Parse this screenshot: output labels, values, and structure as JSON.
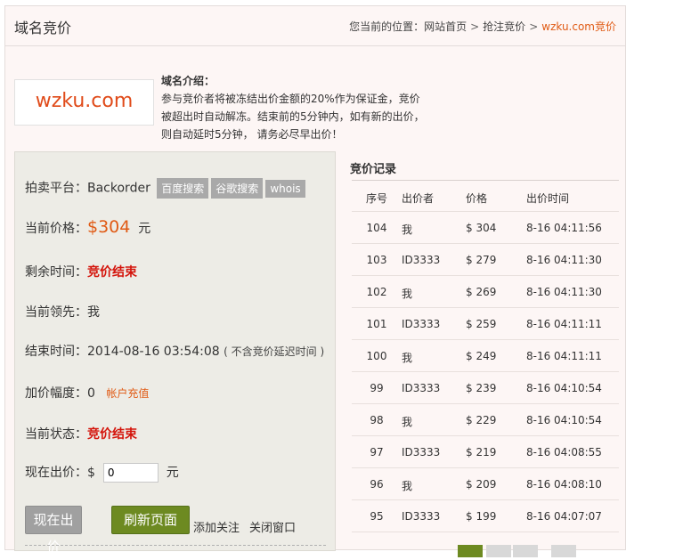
{
  "header": {
    "title": "域名竞价",
    "breadcrumb": {
      "prefix": "您当前的位置：",
      "items": [
        "网站首页",
        "抢注竞价"
      ],
      "separator": ">",
      "current": "wzku.com竞价"
    }
  },
  "domain": {
    "logo_text": "wzku.com",
    "intro_heading": "域名介绍：",
    "intro_lines": [
      "参与竞价者将被冻结出价金额的20%作为保证金，竞价",
      "被超出时自动解冻。结束前的5分钟内，如有新的出价，",
      "则自动延时5分钟， 请务必尽早出价！"
    ]
  },
  "auction": {
    "platform_label": "拍卖平台：",
    "platform_value": "Backorder",
    "tags": [
      "百度搜索",
      "谷歌搜索",
      "whois"
    ],
    "price_label": "当前价格：",
    "price_value": "$304",
    "price_unit": "元",
    "remaining_label": "剩余时间：",
    "remaining_value": "竞价结束",
    "leader_label": "当前领先：",
    "leader_value": "我",
    "end_label": "结束时间：",
    "end_value": "2014-08-16 03:54:08",
    "end_note": "( 不含竞价延迟时间 )",
    "increment_label": "加价幅度：",
    "increment_value": "0",
    "recharge_link": "帐户充值",
    "status_label": "当前状态：",
    "status_value": "竞价结束",
    "bid_label": "现在出价：",
    "bid_currency": "$",
    "bid_input_value": "0",
    "bid_unit": "元",
    "bid_button": "现在出价",
    "refresh_button": "刷新页面",
    "follow_link": "添加关注",
    "close_link": "关闭窗口"
  },
  "records": {
    "title": "竞价记录",
    "columns": [
      "序号",
      "出价者",
      "价格",
      "出价时间"
    ],
    "rows": [
      [
        "104",
        "我",
        "$ 304",
        "8-16 04:11:56"
      ],
      [
        "103",
        "ID3333",
        "$ 279",
        "8-16 04:11:30"
      ],
      [
        "102",
        "我",
        "$ 269",
        "8-16 04:11:30"
      ],
      [
        "101",
        "ID3333",
        "$ 259",
        "8-16 04:11:11"
      ],
      [
        "100",
        "我",
        "$ 249",
        "8-16 04:11:11"
      ],
      [
        "99",
        "ID3333",
        "$ 239",
        "8-16 04:10:54"
      ],
      [
        "98",
        "我",
        "$ 229",
        "8-16 04:10:54"
      ],
      [
        "97",
        "ID3333",
        "$ 219",
        "8-16 04:08:55"
      ],
      [
        "96",
        "我",
        "$ 209",
        "8-16 04:08:10"
      ],
      [
        "95",
        "ID3333",
        "$ 199",
        "8-16 04:07:07"
      ]
    ]
  },
  "colors": {
    "accent_orange": "#e05a14",
    "status_red": "#d4140b",
    "button_green": "#6d8a21"
  }
}
